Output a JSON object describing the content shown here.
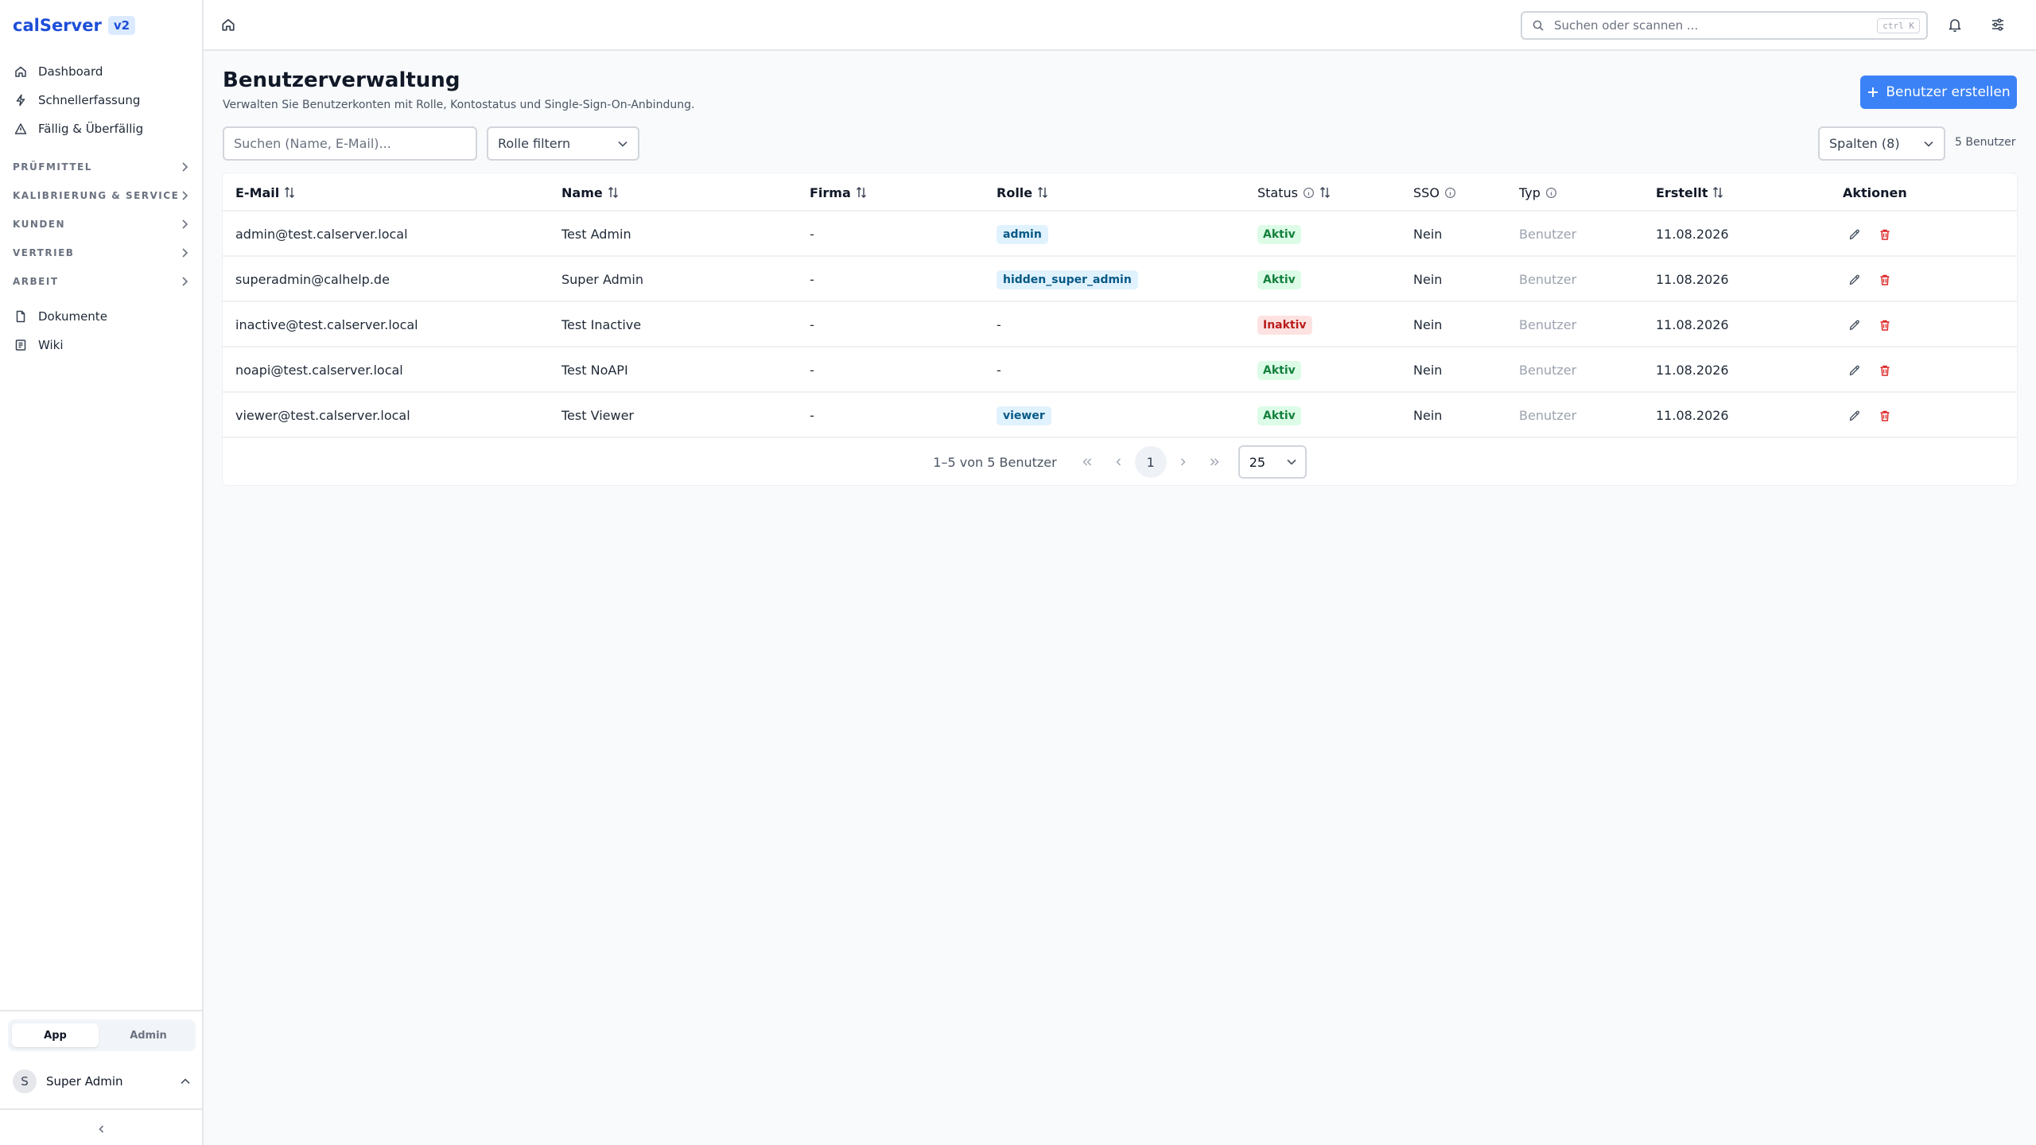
{
  "app": {
    "name": "calServer",
    "version": "v2"
  },
  "sidebar": {
    "items": [
      {
        "label": "Dashboard",
        "icon": "home-icon"
      },
      {
        "label": "Schnellerfassung",
        "icon": "lightning-icon"
      },
      {
        "label": "Fällig & Überfällig",
        "icon": "warning-icon"
      }
    ],
    "groups": [
      {
        "label": "PRÜFMITTEL"
      },
      {
        "label": "KALIBRIERUNG & SERVICE"
      },
      {
        "label": "KUNDEN"
      },
      {
        "label": "VERTRIEB"
      },
      {
        "label": "ARBEIT"
      }
    ],
    "bottom_items": [
      {
        "label": "Dokumente",
        "icon": "document-icon"
      },
      {
        "label": "Wiki",
        "icon": "book-icon"
      }
    ],
    "mode_tabs": [
      "App",
      "Admin"
    ],
    "active_mode": "App",
    "user": {
      "initial": "S",
      "name": "Super Admin"
    }
  },
  "topbar": {
    "search_placeholder": "Suchen oder scannen ...",
    "shortcut": "ctrl K"
  },
  "page": {
    "title": "Benutzerverwaltung",
    "subtitle": "Verwalten Sie Benutzerkonten mit Rolle, Kontostatus und Single-Sign-On-Anbindung.",
    "create_button": "Benutzer erstellen",
    "search_placeholder": "Suchen (Name, E-Mail)...",
    "role_filter": "Rolle filtern",
    "columns_select": "Spalten (8)",
    "user_count": "5 Benutzer"
  },
  "table": {
    "columns": [
      "E-Mail",
      "Name",
      "Firma",
      "Rolle",
      "Status",
      "SSO",
      "Typ",
      "Erstellt",
      "Aktionen"
    ],
    "rows": [
      {
        "email": "admin@test.calserver.local",
        "name": "Test Admin",
        "company": "-",
        "role": "admin",
        "status": "Aktiv",
        "sso": "Nein",
        "type": "Benutzer",
        "created": "11.08.2026"
      },
      {
        "email": "superadmin@calhelp.de",
        "name": "Super Admin",
        "company": "-",
        "role": "hidden_super_admin",
        "status": "Aktiv",
        "sso": "Nein",
        "type": "Benutzer",
        "created": "11.08.2026"
      },
      {
        "email": "inactive@test.calserver.local",
        "name": "Test Inactive",
        "company": "-",
        "role": "-",
        "status": "Inaktiv",
        "sso": "Nein",
        "type": "Benutzer",
        "created": "11.08.2026"
      },
      {
        "email": "noapi@test.calserver.local",
        "name": "Test NoAPI",
        "company": "-",
        "role": "-",
        "status": "Aktiv",
        "sso": "Nein",
        "type": "Benutzer",
        "created": "11.08.2026"
      },
      {
        "email": "viewer@test.calserver.local",
        "name": "Test Viewer",
        "company": "-",
        "role": "viewer",
        "status": "Aktiv",
        "sso": "Nein",
        "type": "Benutzer",
        "created": "11.08.2026"
      }
    ],
    "pagination": {
      "label": "1–5 von 5 Benutzer",
      "current_page": "1",
      "page_size": "25"
    }
  },
  "colors": {
    "accent": "#3b82f6",
    "brand": "#1d4ed8",
    "active": "#15803d",
    "inactive": "#b91c1c"
  }
}
